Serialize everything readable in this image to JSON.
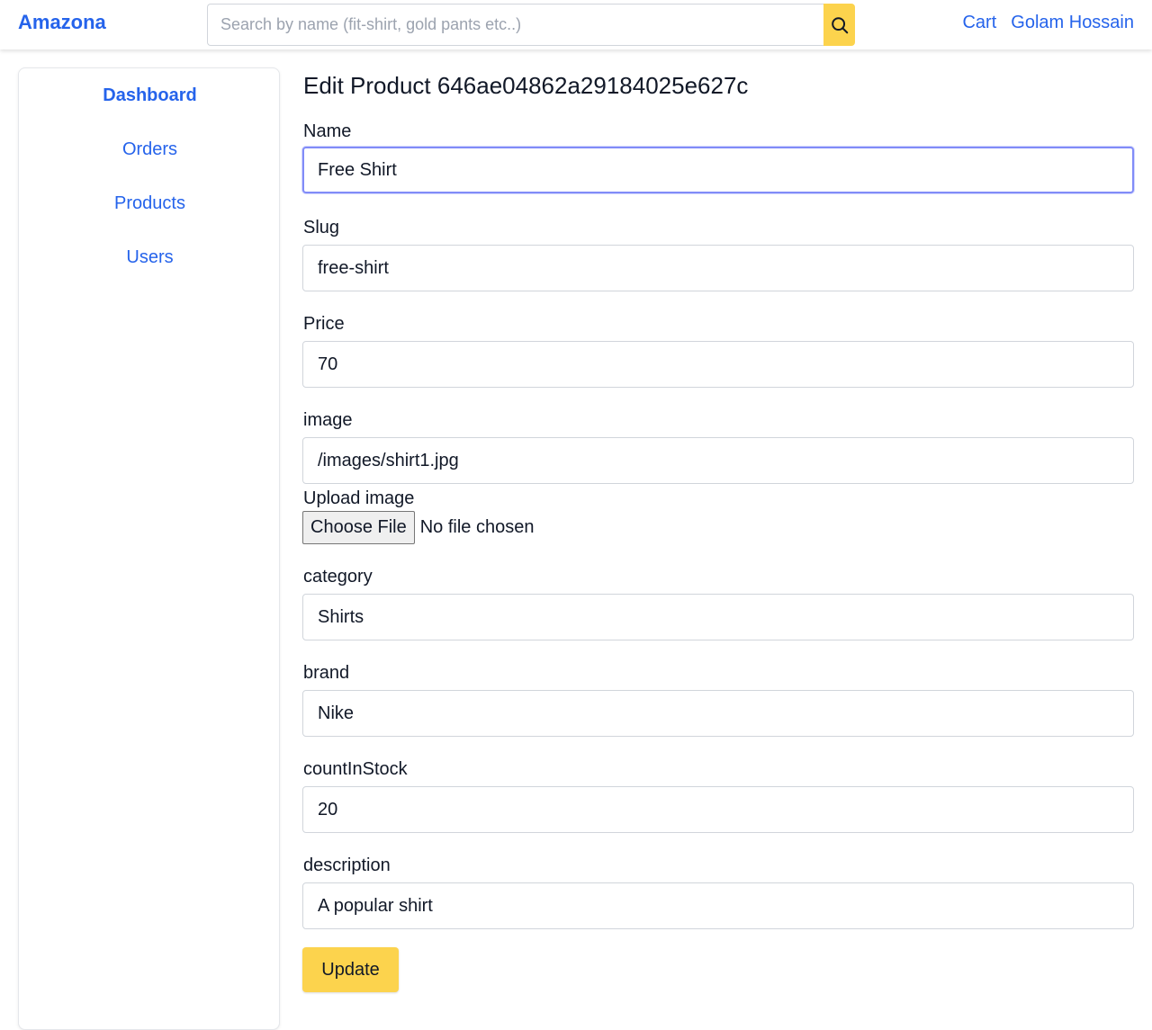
{
  "header": {
    "brand": "Amazona",
    "search": {
      "placeholder": "Search by name (fit-shirt, gold pants etc..)",
      "value": ""
    },
    "search_icon": "search-icon",
    "cart_label": "Cart",
    "user_label": "Golam Hossain"
  },
  "sidebar": {
    "items": [
      {
        "label": "Dashboard",
        "active": true
      },
      {
        "label": "Orders",
        "active": false
      },
      {
        "label": "Products",
        "active": false
      },
      {
        "label": "Users",
        "active": false
      }
    ]
  },
  "form": {
    "title": "Edit Product 646ae04862a29184025e627c",
    "fields": {
      "name": {
        "label": "Name",
        "value": "Free Shirt"
      },
      "slug": {
        "label": "Slug",
        "value": "free-shirt"
      },
      "price": {
        "label": "Price",
        "value": "70"
      },
      "image": {
        "label": "image",
        "value": "/images/shirt1.jpg"
      },
      "category": {
        "label": "category",
        "value": "Shirts"
      },
      "brand": {
        "label": "brand",
        "value": "Nike"
      },
      "countInStock": {
        "label": "countInStock",
        "value": "20"
      },
      "description": {
        "label": "description",
        "value": "A popular shirt"
      }
    },
    "upload": {
      "label": "Upload image",
      "button_label": "Choose File",
      "status": "No file chosen"
    },
    "submit_label": "Update"
  },
  "colors": {
    "accent": "#2563eb",
    "button": "#fcd34d",
    "focus_ring": "#818cf8"
  }
}
